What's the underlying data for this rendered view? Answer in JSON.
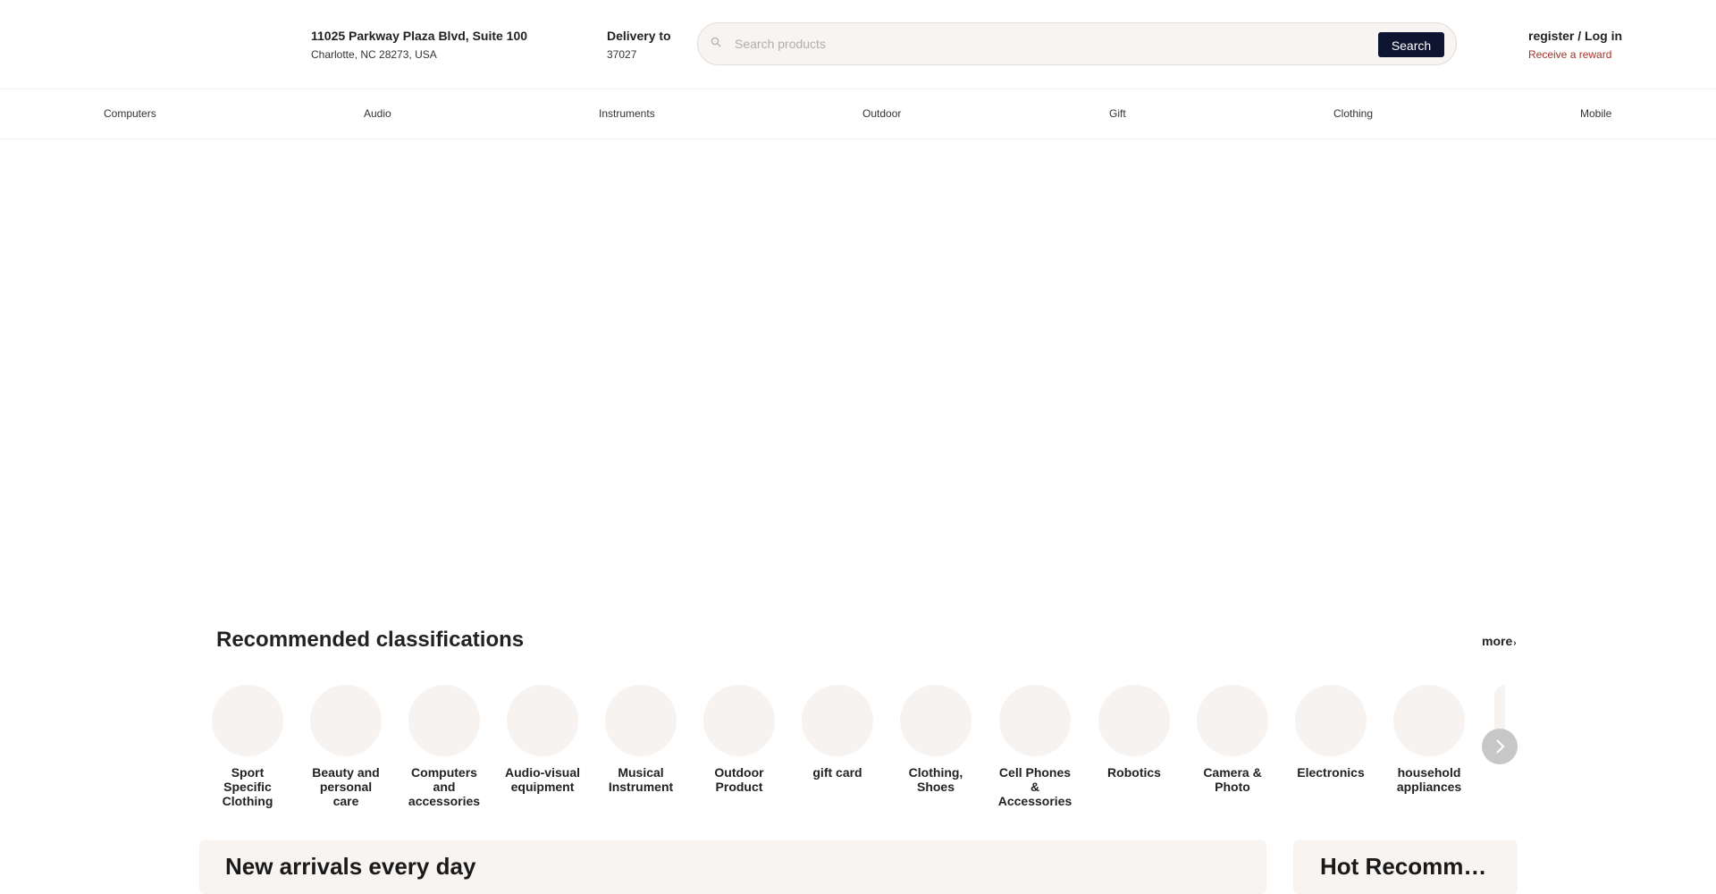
{
  "header": {
    "address_line1": "11025 Parkway Plaza Blvd, Suite 100",
    "address_line2": "Charlotte, NC 28273, USA",
    "delivery_label": "Delivery to",
    "delivery_zip": "37027",
    "search": {
      "placeholder": "Search products",
      "value": "",
      "button_label": "Search",
      "icon": "search-icon"
    },
    "account": {
      "login_label": "register / Log in",
      "reward_label": "Receive a reward"
    }
  },
  "nav": {
    "items": [
      {
        "label": "Computers"
      },
      {
        "label": "Audio"
      },
      {
        "label": "Instruments"
      },
      {
        "label": "Outdoor"
      },
      {
        "label": "Gift"
      },
      {
        "label": "Clothing"
      },
      {
        "label": "Mobile"
      }
    ]
  },
  "recommended": {
    "title": "Recommended classifications",
    "more_label": "more",
    "categories": [
      {
        "label": "Sport Specific Clothing"
      },
      {
        "label": "Beauty and personal care"
      },
      {
        "label": "Computers and accessories"
      },
      {
        "label": "Audio-visual equipment"
      },
      {
        "label": "Musical Instrument"
      },
      {
        "label": "Outdoor Product"
      },
      {
        "label": "gift card"
      },
      {
        "label": "Clothing, Shoes"
      },
      {
        "label": "Cell Phones & Accessories"
      },
      {
        "label": "Robotics"
      },
      {
        "label": "Camera & Photo"
      },
      {
        "label": "Electronics"
      },
      {
        "label": "household appliances"
      }
    ]
  },
  "sections": {
    "new_arrivals_title": "New arrivals every day",
    "hot_title": "Hot Recommendations"
  },
  "colors": {
    "accent_dark": "#0e1530",
    "reward_red": "#a4342a",
    "category_bg": "#f7f3f1"
  }
}
